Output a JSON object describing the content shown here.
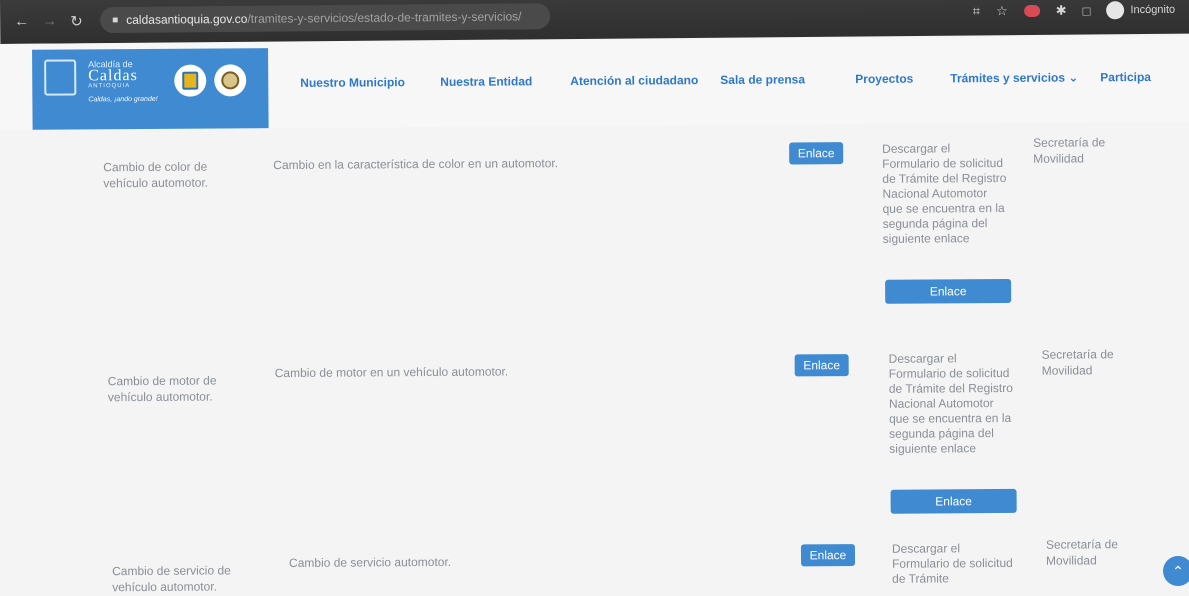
{
  "browser": {
    "url_domain": "caldasantioquia.gov.co",
    "url_path": "/tramites-y-servicios/estado-de-tramites-y-servicios/",
    "incognito_label": "Incógnito"
  },
  "logo": {
    "line1": "Alcaldía de",
    "line2": "Caldas",
    "line3": "ANTIOQUIA",
    "slogan": "Caldas, ¡ando grande!"
  },
  "menu": [
    "Nuestro Municipio",
    "Nuestra Entidad",
    "Atención al ciudadano",
    "Sala de prensa",
    "Proyectos",
    "Trámites y servicios",
    "Participa"
  ],
  "rows": [
    {
      "name": "Cambio de color de vehículo automotor.",
      "description": "Cambio en la característica de color en un automotor.",
      "link_label": "Enlace",
      "form_text": "Descargar el Formulario de solicitud de Trámite del Registro Nacional Automotor que se encuentra en la segunda página del siguiente enlace",
      "form_link_label": "Enlace",
      "department": "Secretaría de Movilidad"
    },
    {
      "name": "Cambio de motor de vehículo automotor.",
      "description": "Cambio de motor en un vehículo automotor.",
      "link_label": "Enlace",
      "form_text": "Descargar el Formulario de solicitud de Trámite del Registro Nacional Automotor que se encuentra en la segunda página del siguiente enlace",
      "form_link_label": "Enlace",
      "department": "Secretaría de Movilidad"
    },
    {
      "name": "Cambio de servicio de vehículo automotor.",
      "description": "Cambio de servicio automotor.",
      "link_label": "Enlace",
      "form_text": "Descargar el Formulario de solicitud de Trámite",
      "department": "Secretaría de Movilidad"
    }
  ],
  "colors": {
    "brand_blue": "#3f8ad0",
    "menu_blue": "#2f78c8",
    "text_gray": "#8a8f96",
    "chrome_dark": "#343434"
  }
}
